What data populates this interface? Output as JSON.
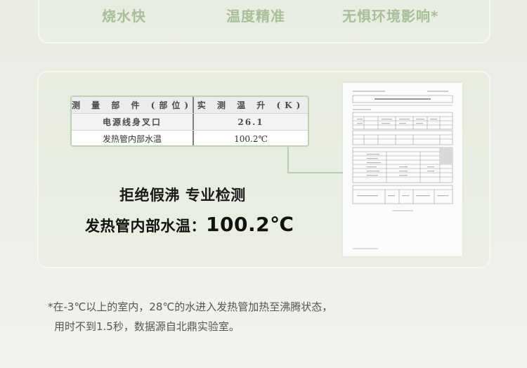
{
  "top_features": [
    {
      "label": "烧水快"
    },
    {
      "label": "温度精准"
    },
    {
      "label": "无惧环境影响*"
    }
  ],
  "measurement_table": {
    "headers": [
      "测 量 部 件 (部位)",
      "实 测 温 升 (K)"
    ],
    "rows": [
      [
        "电源线身叉口",
        "26.1"
      ],
      [
        "发热管内部水温",
        "100.2℃"
      ]
    ]
  },
  "headline": "拒绝假沸 专业检测",
  "temperature": {
    "label": "发热管内部水温：",
    "value": "100.2℃"
  },
  "footnote": {
    "line1": "*在-3℃以上的室内，28℃的水进入发热管加热至沸腾状态，",
    "line2": "用时不到1.5秒，数据源自北鼎实验室。"
  },
  "colors": {
    "feature_text": "#a9bf9a",
    "accent_green": "#b6d0ae",
    "card_bg": "#e8ede0"
  }
}
